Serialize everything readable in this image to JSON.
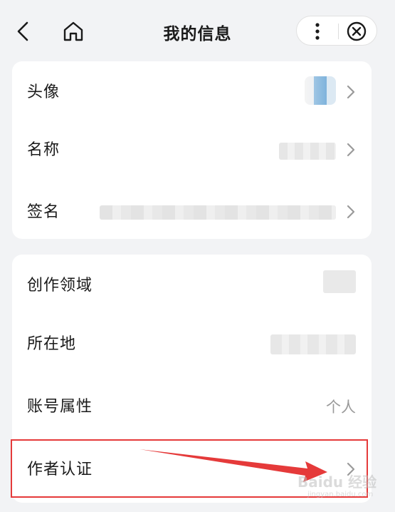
{
  "header": {
    "title": "我的信息",
    "icons": {
      "back": "back-chevron-icon",
      "home": "home-icon",
      "more": "more-vertical-icon",
      "close": "close-circle-icon"
    }
  },
  "profile_section": {
    "avatar_label": "头像",
    "name_label": "名称",
    "signature_label": "签名"
  },
  "account_section": {
    "domain_label": "创作领域",
    "location_label": "所在地",
    "account_type_label": "账号属性",
    "account_type_value": "个人",
    "author_cert_label": "作者认证"
  },
  "annotation": {
    "highlight_color": "#e53a3a"
  },
  "watermark": {
    "main": "Baidu 经验",
    "sub": "jingyan.baidu.com"
  }
}
